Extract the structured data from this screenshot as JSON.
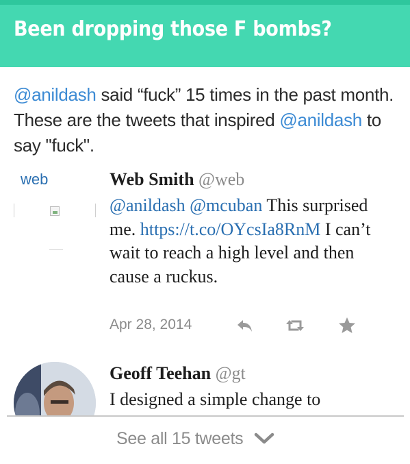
{
  "header": {
    "title": "Been dropping those F bombs?"
  },
  "intro": {
    "mention": "@anildash",
    "text_1": " said “fuck” 15 times in the past month. These are the tweets that inspired ",
    "mention_2": "@anildash",
    "text_2": " to say \"fuck\"."
  },
  "tweets": [
    {
      "avatar_alt": "web",
      "name": "Web Smith",
      "handle": "@web",
      "mention_1": "@anildash",
      "mention_2": "@mcuban",
      "text_1": " This surprised me. ",
      "link": "https://t.co/OYcsIa8RnM",
      "text_2": " I can’t wait to reach a high level and then cause a ruckus.",
      "date": "Apr 28, 2014"
    },
    {
      "name": "Geoff Teehan",
      "handle": "@gt",
      "text": "I designed a simple change to"
    }
  ],
  "footer": {
    "see_all_label": "See all 15 tweets"
  },
  "colors": {
    "header_bg": "#44d8b1",
    "mention": "#3d8bd4",
    "link": "#2a6fb1",
    "muted": "#8b8b8b"
  },
  "icons": {
    "reply": "reply-icon",
    "retweet": "retweet-icon",
    "favorite": "star-icon",
    "expand": "chevron-down-icon"
  }
}
